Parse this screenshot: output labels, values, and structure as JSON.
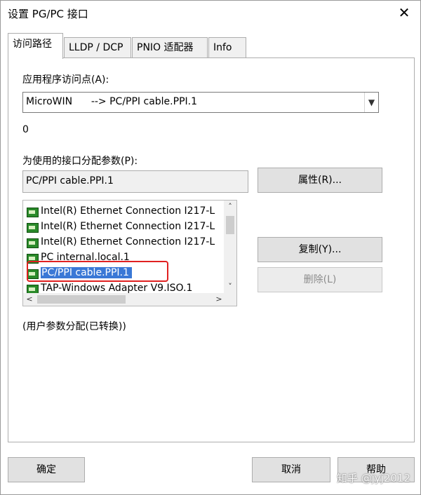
{
  "window": {
    "title": "设置 PG/PC 接口",
    "close_symbol": "✕"
  },
  "tabs": [
    {
      "label": "访问路径",
      "active": true
    },
    {
      "label": "LLDP / DCP",
      "active": false
    },
    {
      "label": "PNIO 适配器",
      "active": false
    },
    {
      "label": "Info",
      "active": false
    }
  ],
  "access_point": {
    "label": "应用程序访问点(A):",
    "value": "MicroWIN      --> PC/PPI cable.PPI.1",
    "arrow": "▼"
  },
  "status_code": "0",
  "interface_params": {
    "label": "为使用的接口分配参数(P):",
    "value": "PC/PPI cable.PPI.1"
  },
  "buttons": {
    "properties": "属性(R)...",
    "copy": "复制(Y)...",
    "delete": "删除(L)",
    "ok": "确定",
    "cancel": "取消",
    "help": "帮助"
  },
  "interface_list": {
    "items": [
      {
        "label": "Intel(R) Ethernet Connection I217-L",
        "selected": false
      },
      {
        "label": "Intel(R) Ethernet Connection I217-L",
        "selected": false
      },
      {
        "label": "Intel(R) Ethernet Connection I217-L",
        "selected": false
      },
      {
        "label": "PC internal.local.1",
        "selected": false
      },
      {
        "label": "PC/PPI cable.PPI.1",
        "selected": true
      },
      {
        "label": "TAP-Windows Adapter V9.ISO.1",
        "selected": false
      }
    ],
    "scroll_up": "˄",
    "scroll_down": "˅",
    "scroll_left": "<",
    "scroll_right": ">"
  },
  "user_param_note": "(用户参数分配(已转换))",
  "watermark": "知乎 @jyj2012",
  "colors": {
    "selection": "#3a78d6",
    "highlight_box": "#e02020"
  }
}
